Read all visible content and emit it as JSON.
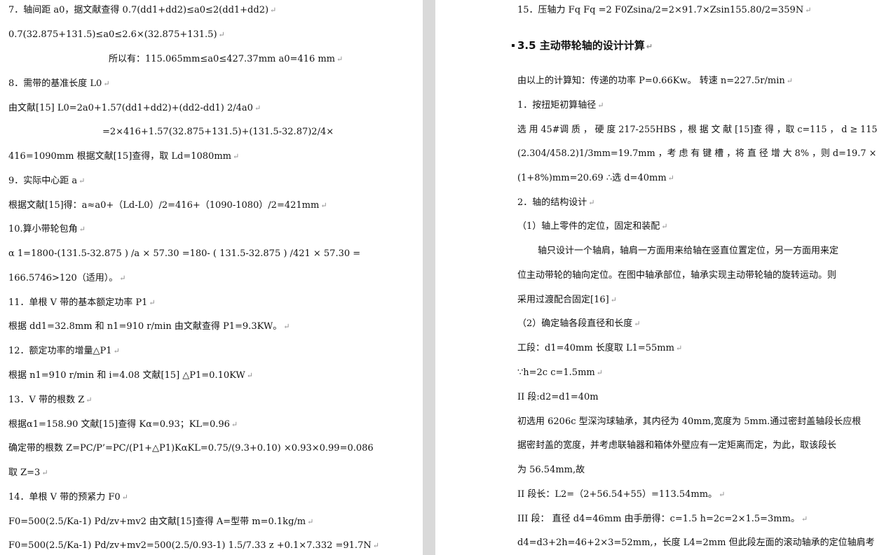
{
  "left_lines": [
    "7．轴间距 a0，据文献查得 0.7(dd1+dd2)≤a0≤2(dd1+dd2)",
    "0.7(32.875+131.5)≤a0≤2.6×(32.875+131.5)",
    "所以有：115.065mm≤a0≤427.37mm        a0=416 mm",
    "8．需带的基准长度 L0",
    "由文献[15]            L0=2a0+1.57(dd1+dd2)+(dd2-dd1) 2/4a0",
    "=2×416+1.57(32.875+131.5)+(131.5-32.87)2/4×",
    "416=1090mm 根据文献[15]查得，取 Ld=1080mm",
    "9．实际中心距 a",
    "根据文献[15]得：a≈a0+（Ld-L0）/2=416+（1090-1080）/2=421mm",
    "10.算小带轮包角",
    "α 1=1800-(131.5-32.875 ) /a × 57.30  =180- ( 131.5-32.875 ) /421 × 57.30     =",
    "166.5746>120（适用）。",
    "11．单根 V 带的基本额定功率 P1",
    "根据 dd1=32.8mm 和 n1=910 r/min 由文献查得 P1=9.3KW。",
    "12．额定功率的增量△P1",
    "根据 n1=910 r/min 和 i=4.08 文献[15]   △P1=0.10KW",
    "13．V 带的根数 Z",
    "根据α1=158.90 文献[15]查得 Kα=0.93；KL=0.96",
    "确定带的根数  Z=PC/P’=PC/(P1+△P1)KαKL=0.75/(9.3+0.10)  ×0.93×0.99=0.086",
    "取 Z=3",
    "14．单根 V 带的预紧力 F0",
    "F0=500(2.5/Ka-1) Pd/zv+mv2 由文献[15]查得 A=型带 m=0.1kg/m",
    "F0=500(2.5/Ka-1) Pd/zv+mv2=500(2.5/0.93-1) 1.5/7.33 z +0.1×7.332 =91.7N"
  ],
  "right_lines": [
    "15．压轴力 Fq      Fq   =2 F0Zsina/2=2×91.7×Zsin155.80/2=359N",
    "3.5 主动带轮轴的设计计算",
    "由以上的计算知：传递的功率 P=0.66Kw。  转速 n=227.5r/min",
    "1．按扭矩初算轴径",
    "选 用  45#调 质 ， 硬 度  217-255HBS ，根 据 文 献 [15]查 得 ，取   c=115 ，  d ≥ 115",
    "(2.304/458.2)1/3mm=19.7mm ，考 虑 有 键 槽 ，将 直 径 增 大   8% ，则   d=19.7 ×",
    "(1+8%)mm=20.69      ∴选 d=40mm",
    "2．轴的结构设计",
    "（1）轴上零件的定位，固定和装配",
    "轴只设计一个轴肩，轴肩一方面用来给轴在竖直位置定位，另一方面用来定",
    "位主动带轮的轴向定位。在图中轴承部位，轴承实现主动带轮轴的旋转运动。则",
    "采用过渡配合固定[16]",
    "（2）确定轴各段直径和长度",
    "工段：d1=40mm      长度取 L1=55mm",
    "∵h=2c        c=1.5mm",
    "II 段:d2=d1=40m",
    "初选用 6206c 型深沟球轴承，其内径为 40mm,宽度为 5mm.通过密封盖轴段长应根",
    "据密封盖的宽度，并考虑联轴器和箱体外壁应有一定矩离而定，为此，取该段长",
    "为 56.54mm,故",
    "II 段长：L2=（2+56.54+55）=113.54mm。",
    "III 段：  直径 d4=46mm 由手册得：c=1.5      h=2c=2×1.5=3mm。",
    "d4=d3+2h=46+2×3=52mm,，长度 L4=2mm  但此段左面的滚动轴承的定位轴肩考"
  ],
  "paragraph_mark": "↵"
}
